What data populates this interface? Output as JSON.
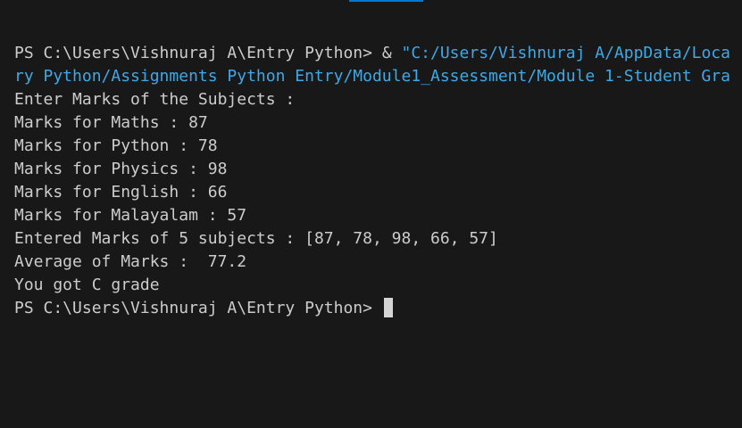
{
  "terminal": {
    "command": {
      "prompt": "PS C:\\Users\\Vishnuraj A\\Entry Python> ",
      "operator": "& ",
      "path_part1": "\"C:/Users/Vishnuraj A/AppData/Loca",
      "path_part2": "ry Python/Assignments Python Entry/Module1_Assessment/Module 1-Student Gra"
    },
    "output": [
      "Enter Marks of the Subjects :",
      "Marks for Maths : 87",
      "Marks for Python : 78",
      "Marks for Physics : 98",
      "Marks for English : 66",
      "Marks for Malayalam : 57",
      "Entered Marks of 5 subjects : [87, 78, 98, 66, 57]",
      "Average of Marks :  77.2",
      "You got C grade"
    ],
    "final_prompt": "PS C:\\Users\\Vishnuraj A\\Entry Python> "
  },
  "colors": {
    "background": "#181818",
    "text": "#cccccc",
    "string": "#3fa8e6",
    "accent": "#0078d4"
  }
}
